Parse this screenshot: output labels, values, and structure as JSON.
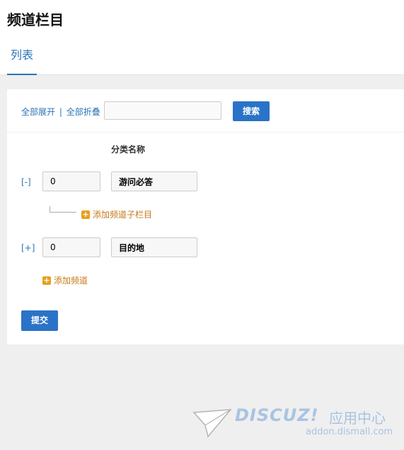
{
  "page": {
    "title": "频道栏目"
  },
  "tabs": [
    {
      "label": "列表"
    }
  ],
  "toolbar": {
    "expand_all": "全部展开",
    "separator": "|",
    "collapse_all": "全部折叠",
    "search_value": "",
    "search_label": "搜索"
  },
  "table": {
    "column_name": "分类名称"
  },
  "rows": [
    {
      "toggle": "[-]",
      "order": "0",
      "name": "游问必答",
      "add_child": "添加频道子栏目"
    },
    {
      "toggle": "[+]",
      "order": "0",
      "name": "目的地"
    }
  ],
  "add_channel": "添加频道",
  "submit_label": "提交",
  "watermark": {
    "logo": "DISCUZ!",
    "cn": "应用中心",
    "url": "addon.dismall.com"
  },
  "colors": {
    "accent": "#2b73c8",
    "link": "#2b73b7",
    "add": "#c8781a",
    "plus": "#e6a020"
  }
}
